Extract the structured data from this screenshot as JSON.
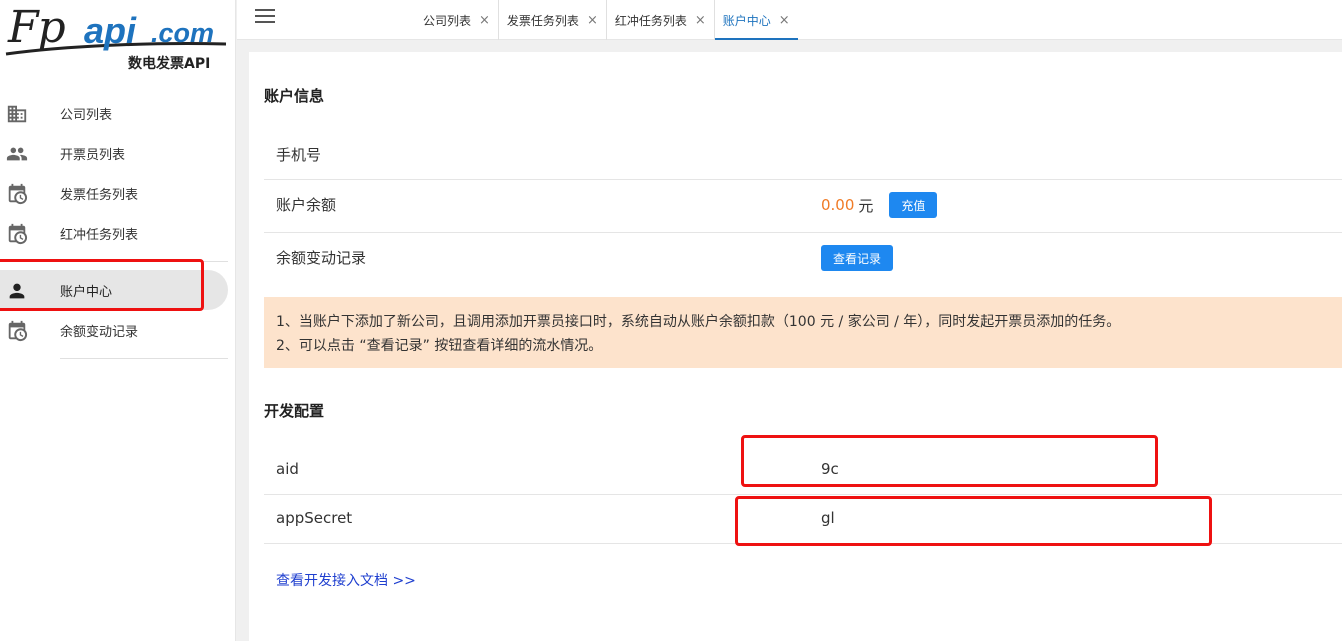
{
  "brand": {
    "fp": "Fp",
    "api": "api",
    "com": ".com",
    "subtitle": "数电发票API"
  },
  "sidebar": {
    "items": [
      {
        "label": "公司列表",
        "icon": "building-icon"
      },
      {
        "label": "开票员列表",
        "icon": "people-icon"
      },
      {
        "label": "发票任务列表",
        "icon": "calendar-clock-icon"
      },
      {
        "label": "红冲任务列表",
        "icon": "calendar-clock-icon"
      },
      {
        "label": "账户中心",
        "icon": "person-icon",
        "active": true
      },
      {
        "label": "余额变动记录",
        "icon": "calendar-clock-icon"
      }
    ]
  },
  "tabs": [
    {
      "label": "公司列表",
      "close": "×"
    },
    {
      "label": "发票任务列表",
      "close": "×"
    },
    {
      "label": "红冲任务列表",
      "close": "×"
    },
    {
      "label": "账户中心",
      "close": "×",
      "active": true
    }
  ],
  "account": {
    "title": "账户信息",
    "phone_label": "手机号",
    "phone_value": "",
    "balance_label": "账户余额",
    "balance_amount": "0.00",
    "balance_unit": "元",
    "recharge_button": "充值",
    "records_label": "余额变动记录",
    "records_button": "查看记录"
  },
  "notice": {
    "line1": "1、当账户下添加了新公司，且调用添加开票员接口时，系统自动从账户余额扣款（100 元 / 家公司 / 年），同时发起开票员添加的任务。",
    "line2": "2、可以点击 “查看记录” 按钮查看详细的流水情况。"
  },
  "dev": {
    "title": "开发配置",
    "aid_label": "aid",
    "aid_value": "9c",
    "secret_label": "appSecret",
    "secret_value": "gl",
    "doc_link": "查看开发接入文档 >>"
  },
  "colors": {
    "accent": "#1e88f0",
    "amount": "#f07b26",
    "notice_bg": "#fde3cc",
    "highlight": "#e11111"
  }
}
